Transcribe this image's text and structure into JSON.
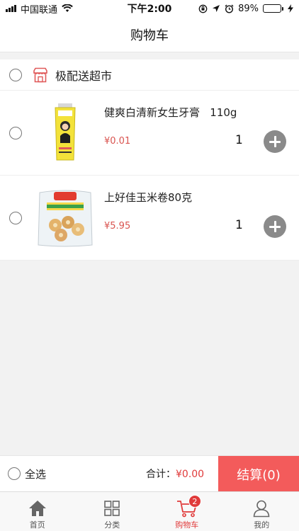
{
  "status_bar": {
    "carrier": "中国联通",
    "time": "下午2:00",
    "battery": "89%",
    "battery_level": 0.89,
    "icons": [
      "signal-icon",
      "wifi-icon",
      "orientation-lock-icon",
      "location-icon",
      "alarm-icon",
      "battery-icon"
    ]
  },
  "header": {
    "title": "购物车"
  },
  "store": {
    "name": "极配送超市",
    "icon": "store-icon"
  },
  "items": [
    {
      "name": "健爽白清新女生牙膏   110g",
      "price": "¥0.01",
      "qty": "1"
    },
    {
      "name": "上好佳玉米卷80克",
      "price": "¥5.95",
      "qty": "1"
    }
  ],
  "checkout": {
    "select_all": "全选",
    "total_label": "合计：",
    "total_amount": "¥0.00",
    "button": "结算(0)"
  },
  "tabbar": {
    "items": [
      {
        "label": "首页",
        "icon": "home-icon"
      },
      {
        "label": "分类",
        "icon": "category-grid-icon"
      },
      {
        "label": "购物车",
        "icon": "cart-icon",
        "badge": "2"
      },
      {
        "label": "我的",
        "icon": "user-icon"
      }
    ]
  },
  "colors": {
    "accent": "#e03a3a",
    "checkout_button": "#f35b5b",
    "price": "#d9534f"
  }
}
